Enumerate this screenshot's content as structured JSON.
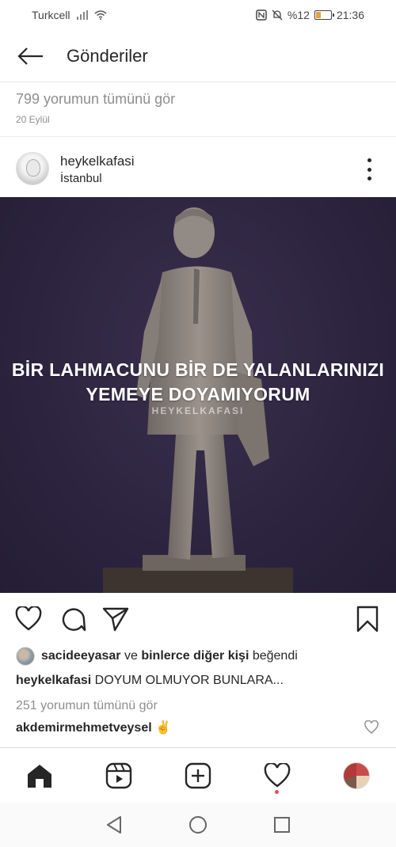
{
  "status_bar": {
    "carrier": "Turkcell",
    "battery_percent": "%12",
    "time": "21:36"
  },
  "header": {
    "title": "Gönderiler"
  },
  "previous_post": {
    "view_comments": "799 yorumun tümünü gör",
    "date": "20 Eylül"
  },
  "post": {
    "username": "heykelkafasi",
    "location": "İstanbul",
    "image": {
      "overlay_line1": "BİR LAHMACUNU BİR DE YALANLARINIZI",
      "overlay_line2": "YEMEYE DOYAMIYORUM",
      "watermark": "HEYKELKAFASI",
      "background_color": "#2d2540"
    },
    "likes": {
      "liker": "sacideeyasar",
      "connector": " ve ",
      "others": "binlerce diğer kişi",
      "suffix": " beğendi"
    },
    "caption": {
      "username": "heykelkafasi",
      "text": " DOYUM OLMUYOR BUNLARA..."
    },
    "view_comments": "251 yorumun tümünü gör",
    "comment": {
      "username": "akdemirmehmetveysel",
      "text": " ✌️"
    }
  },
  "icons": {
    "accent_notification": "#ed4956"
  }
}
